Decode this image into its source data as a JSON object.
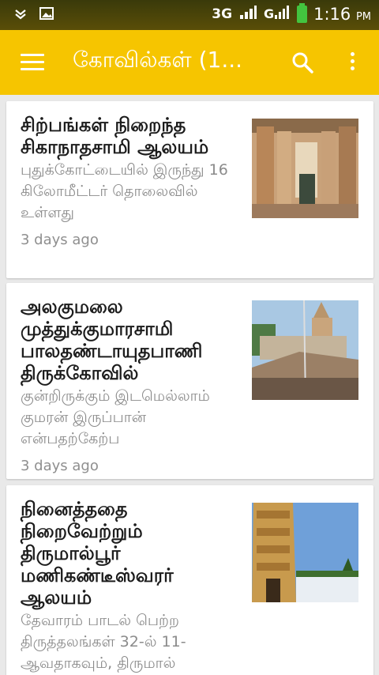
{
  "status": {
    "network": "3G",
    "time": "1:16",
    "ampm": "PM"
  },
  "appbar": {
    "title": "கோவில்கள் (1..."
  },
  "articles": [
    {
      "title": "சிற்பங்கள் நிறைந்த சிகாநாதசாமி ஆலயம்",
      "description": "புதுக்கோட்டையில் இருந்து 16 கிலோமீட்டர் தொலைவில் உள்ளது",
      "time": "3 days ago"
    },
    {
      "title": "அலகுமலை முத்துக்குமாரசாமி பாலதண்டாயுதபாணி திருக்கோவில்",
      "description": "குன்றிருக்கும் இடமெல்லாம் குமரன் இருப்பான் என்பதற்கேற்ப",
      "time": "3 days ago"
    },
    {
      "title": "நினைத்ததை நிறைவேற்றும் திருமால்பூர் மணிகண்டீஸ்வரர் ஆலயம்",
      "description": "தேவாரம் பாடல் பெற்ற திருத்தலங்கள் 32-ல் 11-ஆவதாகவும், திருமால்",
      "time": ""
    }
  ]
}
